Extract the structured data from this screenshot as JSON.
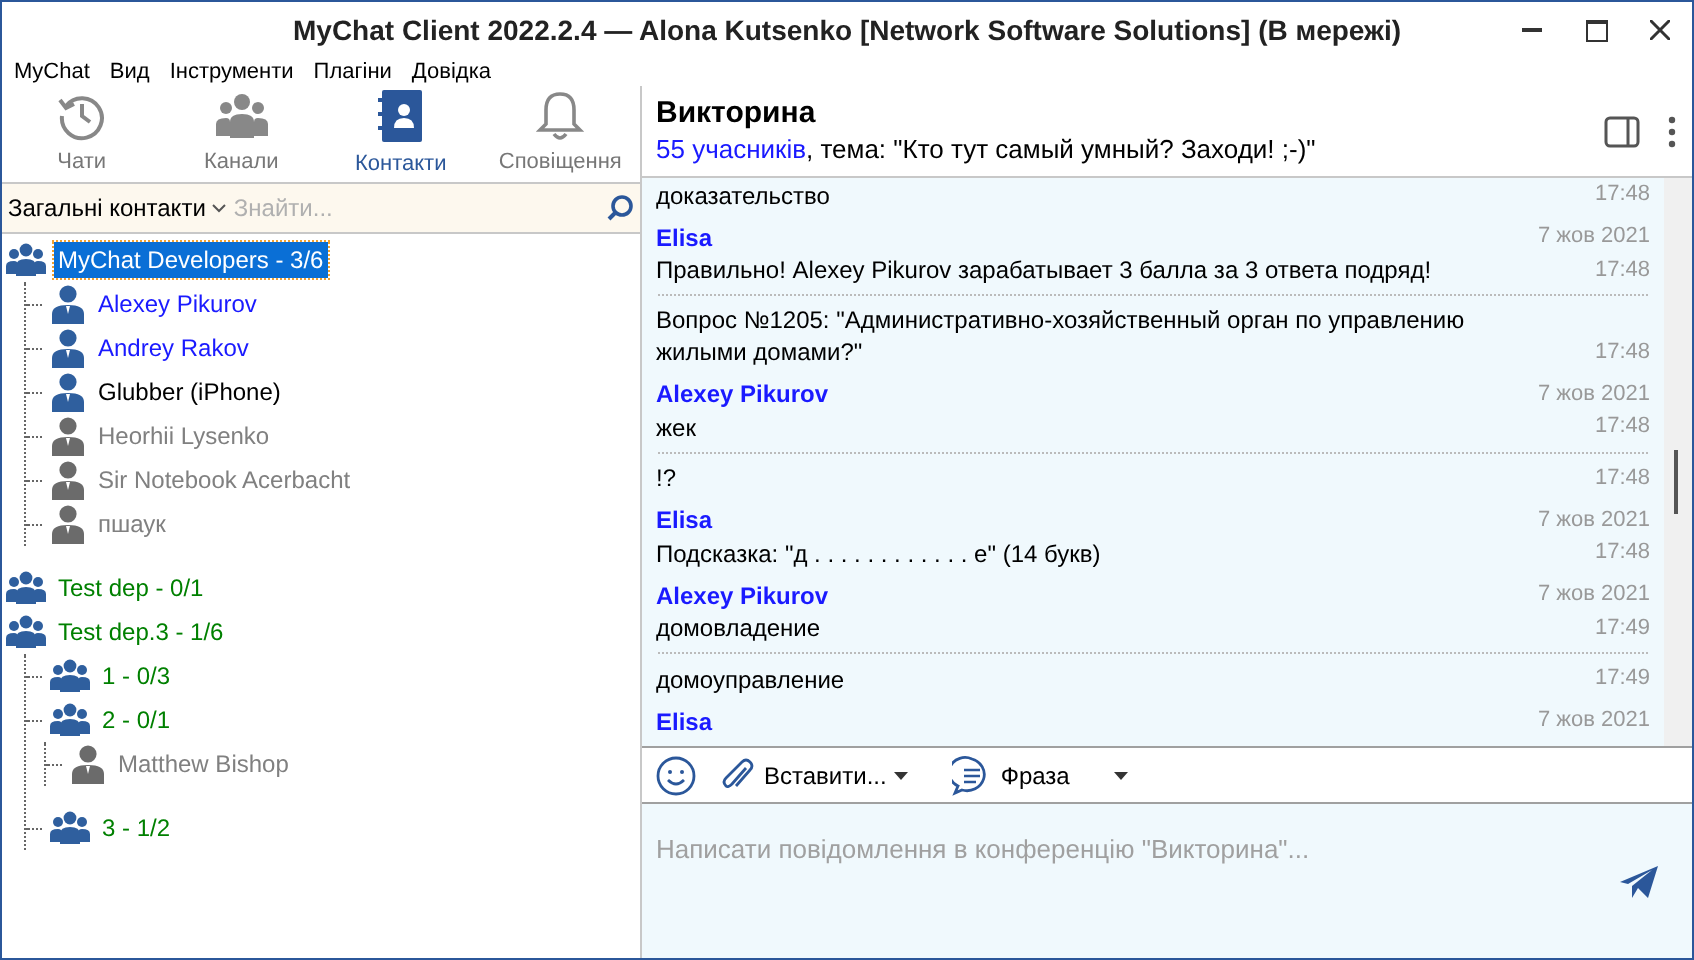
{
  "window": {
    "title": "MyChat Client 2022.2.4 — Alona Kutsenko [Network Software Solutions] (В мережі)"
  },
  "menu": [
    "MyChat",
    "Вид",
    "Інструменти",
    "Плагіни",
    "Довідка"
  ],
  "nav_tabs": [
    {
      "label": "Чати",
      "kind": "history",
      "selected": false
    },
    {
      "label": "Канали",
      "kind": "channels",
      "selected": false
    },
    {
      "label": "Контакти",
      "kind": "contacts",
      "selected": true
    },
    {
      "label": "Сповіщення",
      "kind": "bell",
      "selected": false
    }
  ],
  "contacts_filter": {
    "label": "Загальні контакти",
    "placeholder": "Знайти..."
  },
  "tree": [
    {
      "kind": "group",
      "label": "MyChat Developers - 3/6",
      "selected": true,
      "children": [
        {
          "kind": "user",
          "label": "Alexey Pikurov",
          "color": "#1a1aff",
          "online": true,
          "selected": false
        },
        {
          "kind": "user",
          "label": "Andrey Rakov",
          "color": "#1a1aff",
          "online": true,
          "selected": false
        },
        {
          "kind": "user",
          "label": "Glubber (iPhone)",
          "color": "#000000",
          "online": true,
          "selected": false
        },
        {
          "kind": "user",
          "label": "Heorhii Lysenko",
          "color": "#808080",
          "online": false,
          "selected": false
        },
        {
          "kind": "user",
          "label": "Sir Notebook Acerbacht",
          "color": "#808080",
          "online": false,
          "selected": false
        },
        {
          "kind": "user",
          "label": "пшаук",
          "color": "#808080",
          "online": false,
          "selected": false
        }
      ]
    },
    {
      "kind": "group",
      "label": "Test dep - 0/1",
      "color": "#008000",
      "selected": false
    },
    {
      "kind": "group",
      "label": "Test dep.3 - 1/6",
      "color": "#008000",
      "selected": false,
      "children": [
        {
          "kind": "group",
          "label": "1 - 0/3",
          "color": "#008000",
          "selected": false
        },
        {
          "kind": "group",
          "label": "2 - 0/1",
          "color": "#008000",
          "selected": false,
          "children": [
            {
              "kind": "user",
              "label": "Matthew Bishop",
              "color": "#808080",
              "online": false,
              "selected": false
            }
          ]
        },
        {
          "kind": "group",
          "label": "3 - 1/2",
          "color": "#008000",
          "selected": false
        }
      ]
    }
  ],
  "chat": {
    "title": "Викторина",
    "members": "55 учасників",
    "topic": ", тема: \"Кто тут самый умный? Заходи! ;-)\""
  },
  "messages": [
    {
      "text": "доказательство",
      "time": "17:48",
      "group_end": false
    },
    {
      "author": "Elisa",
      "date": "7 жов 2021",
      "text": "Правильно! Alexey Pikurov зарабатывает 3 балла за 3 ответа подряд!",
      "time": "17:48",
      "group_end": true
    },
    {
      "text": "Вопрос №1205: \"Административно-хозяйственный орган по управлению жилыми домами?\"",
      "time": "17:48",
      "group_end": false
    },
    {
      "author": "Alexey Pikurov",
      "date": "7 жов 2021",
      "text": "жек",
      "time": "17:48",
      "group_end": true
    },
    {
      "text": "!?",
      "time": "17:48",
      "group_end": false
    },
    {
      "author": "Elisa",
      "date": "7 жов 2021",
      "text": "Подсказка: \"д . . . . . . . . . . . . е\" (14 букв)",
      "time": "17:48",
      "group_end": false
    },
    {
      "author": "Alexey Pikurov",
      "date": "7 жов 2021",
      "text": "домовладение",
      "time": "17:49",
      "group_end": true
    },
    {
      "text": "домоуправление",
      "time": "17:49",
      "group_end": false
    },
    {
      "author": "Elisa",
      "date": "7 жов 2021",
      "group_end": false
    }
  ],
  "composer": {
    "insert_label": "Вставити...",
    "phrase_label": "Фраза",
    "placeholder": "Написати повідомлення в конференцію \"Викторина\"..."
  }
}
